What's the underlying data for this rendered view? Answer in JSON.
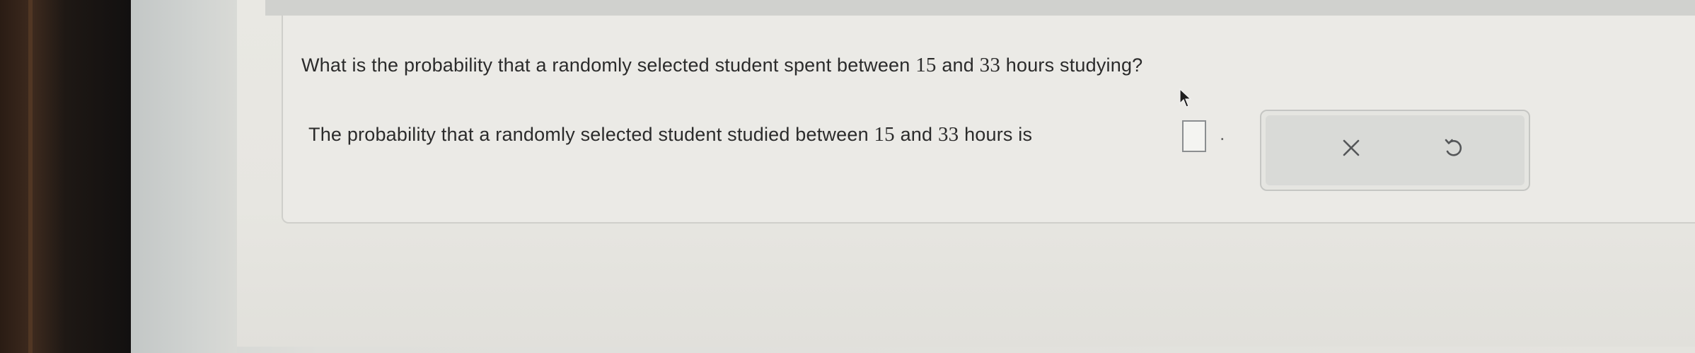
{
  "question": {
    "prefix": "What is the probability that a randomly selected student spent between",
    "lower": "15",
    "middle": "and",
    "upper": "33",
    "suffix": "hours studying?"
  },
  "answer": {
    "prefix": "The probability that a randomly selected student studied between",
    "lower": "15",
    "middle": "and",
    "upper": "33",
    "suffix": "hours is",
    "value": "",
    "punctuation": "."
  },
  "actions": {
    "clear_icon": "close-icon",
    "undo_icon": "undo-icon"
  },
  "colors": {
    "text": "#2b2b2b",
    "icon": "#555759",
    "input_border": "#8b8e90"
  }
}
